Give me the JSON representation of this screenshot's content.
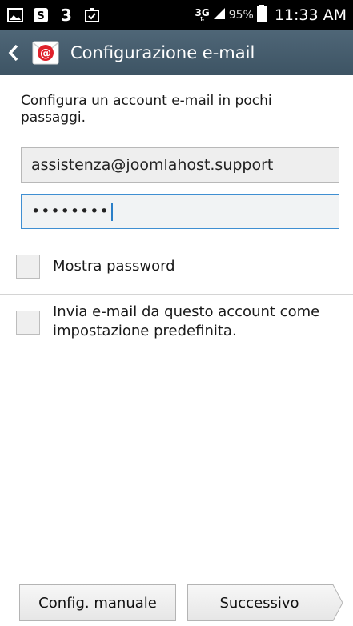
{
  "statusbar": {
    "network": "3G",
    "battery": "95%",
    "time": "11:33 AM"
  },
  "actionbar": {
    "title": "Configurazione e-mail"
  },
  "form": {
    "intro": "Configura un account e-mail in pochi passaggi.",
    "email_value": "assistenza@joomlahost.support",
    "password_value": "••••••••"
  },
  "options": {
    "show_password": "Mostra password",
    "default_account": "Invia e-mail da questo account come impostazione predefinita."
  },
  "buttons": {
    "manual": "Config. manuale",
    "next": "Successivo"
  },
  "colors": {
    "actionbar": "#4a6172",
    "focus_border": "#3f8fd2"
  }
}
